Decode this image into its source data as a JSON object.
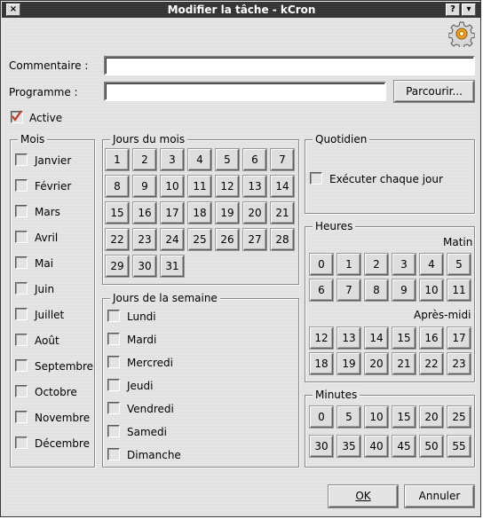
{
  "window": {
    "title": "Modifier la tâche - kCron",
    "close_glyph": "×",
    "help_glyph": "?",
    "menu_glyph": "▾"
  },
  "form": {
    "comment_label": "Commentaire :",
    "comment_value": "",
    "program_label": "Programme :",
    "program_value": "",
    "browse_label": "Parcourir...",
    "active_label": "Active",
    "active_checked": true
  },
  "months": {
    "title": "Mois",
    "items": [
      "Janvier",
      "Février",
      "Mars",
      "Avril",
      "Mai",
      "Juin",
      "Juillet",
      "Août",
      "Septembre",
      "Octobre",
      "Novembre",
      "Décembre"
    ]
  },
  "days_of_month": {
    "title": "Jours du mois",
    "items": [
      "1",
      "2",
      "3",
      "4",
      "5",
      "6",
      "7",
      "8",
      "9",
      "10",
      "11",
      "12",
      "13",
      "14",
      "15",
      "16",
      "17",
      "18",
      "19",
      "20",
      "21",
      "22",
      "23",
      "24",
      "25",
      "26",
      "27",
      "28",
      "29",
      "30",
      "31"
    ]
  },
  "weekdays": {
    "title": "Jours de la semaine",
    "items": [
      "Lundi",
      "Mardi",
      "Mercredi",
      "Jeudi",
      "Vendredi",
      "Samedi",
      "Dimanche"
    ]
  },
  "daily": {
    "title": "Quotidien",
    "checkbox_label": "Exécuter chaque jour"
  },
  "hours": {
    "title": "Heures",
    "morning_label": "Matin",
    "afternoon_label": "Après-midi",
    "morning": [
      "0",
      "1",
      "2",
      "3",
      "4",
      "5",
      "6",
      "7",
      "8",
      "9",
      "10",
      "11"
    ],
    "afternoon": [
      "12",
      "13",
      "14",
      "15",
      "16",
      "17",
      "18",
      "19",
      "20",
      "21",
      "22",
      "23"
    ]
  },
  "minutes": {
    "title": "Minutes",
    "items": [
      "0",
      "5",
      "10",
      "15",
      "20",
      "25",
      "30",
      "35",
      "40",
      "45",
      "50",
      "55"
    ]
  },
  "buttons": {
    "ok": "OK",
    "cancel": "Annuler"
  },
  "icons": {
    "app": "kcron-gear-icon",
    "check": "checkmark-icon"
  },
  "colors": {
    "titlebar": "#2f2f2f",
    "window_bg": "#e4e4e4",
    "check_mark": "#c0392b"
  }
}
